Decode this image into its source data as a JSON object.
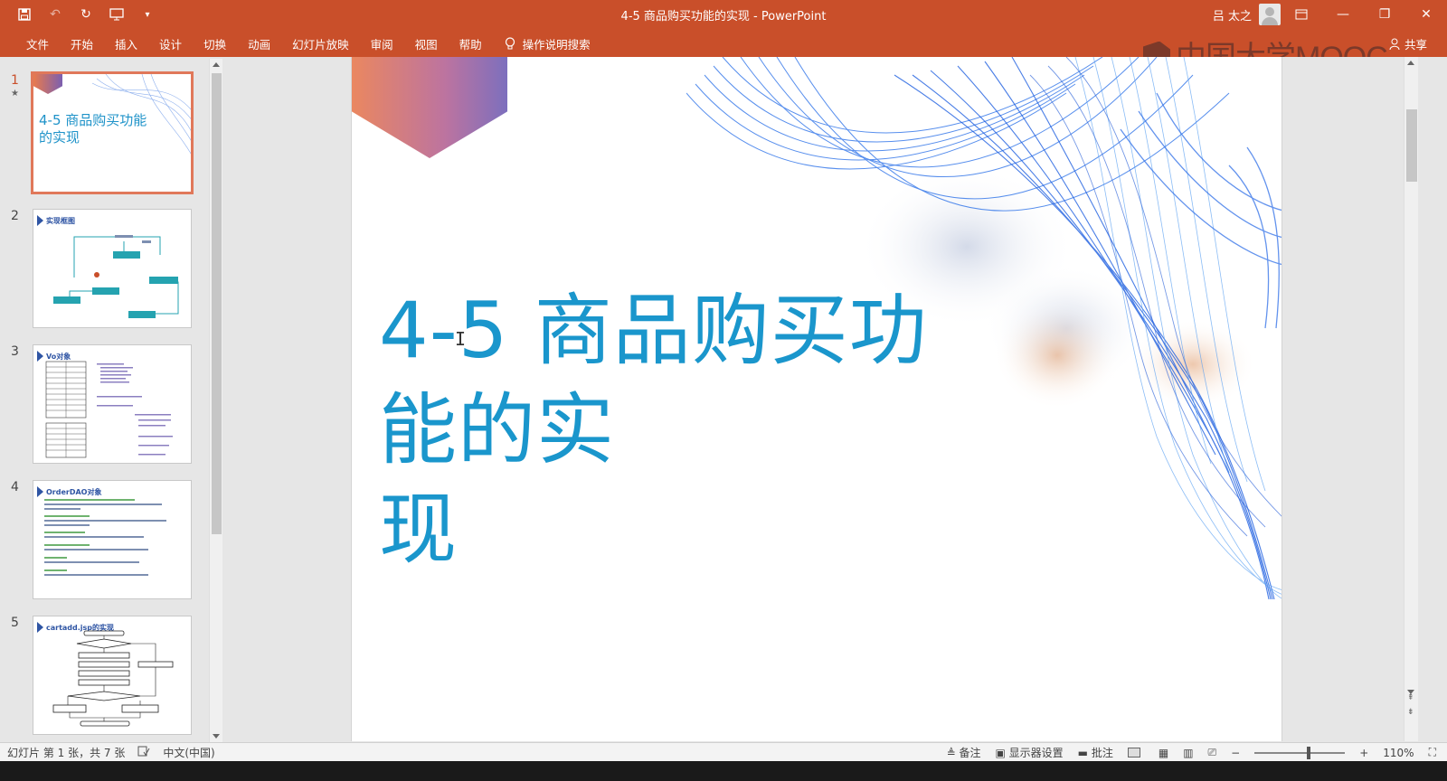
{
  "app": {
    "title": "4-5 商品购买功能的实现 - PowerPoint",
    "user": "吕 太之",
    "share_label": "共享",
    "watermark": "中国大学MOOC",
    "accent": "#c94f2a"
  },
  "ribbon": {
    "tabs": [
      "文件",
      "开始",
      "插入",
      "设计",
      "切换",
      "动画",
      "幻灯片放映",
      "审阅",
      "视图",
      "帮助"
    ],
    "search_label": "操作说明搜索"
  },
  "thumbnails": [
    {
      "num": "1",
      "title": "4-5 商品购买功能的实现",
      "selected": true
    },
    {
      "num": "2",
      "heading": "实现框图"
    },
    {
      "num": "3",
      "heading": "Vo对象"
    },
    {
      "num": "4",
      "heading": "OrderDAO对象"
    },
    {
      "num": "5",
      "heading": "cartadd.jsp的实现"
    }
  ],
  "slide": {
    "title_line1": "4-5 商品购买功能的实",
    "title_line2": "现",
    "title_color": "#1a96cc"
  },
  "status": {
    "slide_info": "幻灯片 第 1 张，共 7 张",
    "language": "中文(中国)",
    "notes": "备注",
    "display_settings": "显示器设置",
    "comments": "批注",
    "zoom": "110%"
  }
}
